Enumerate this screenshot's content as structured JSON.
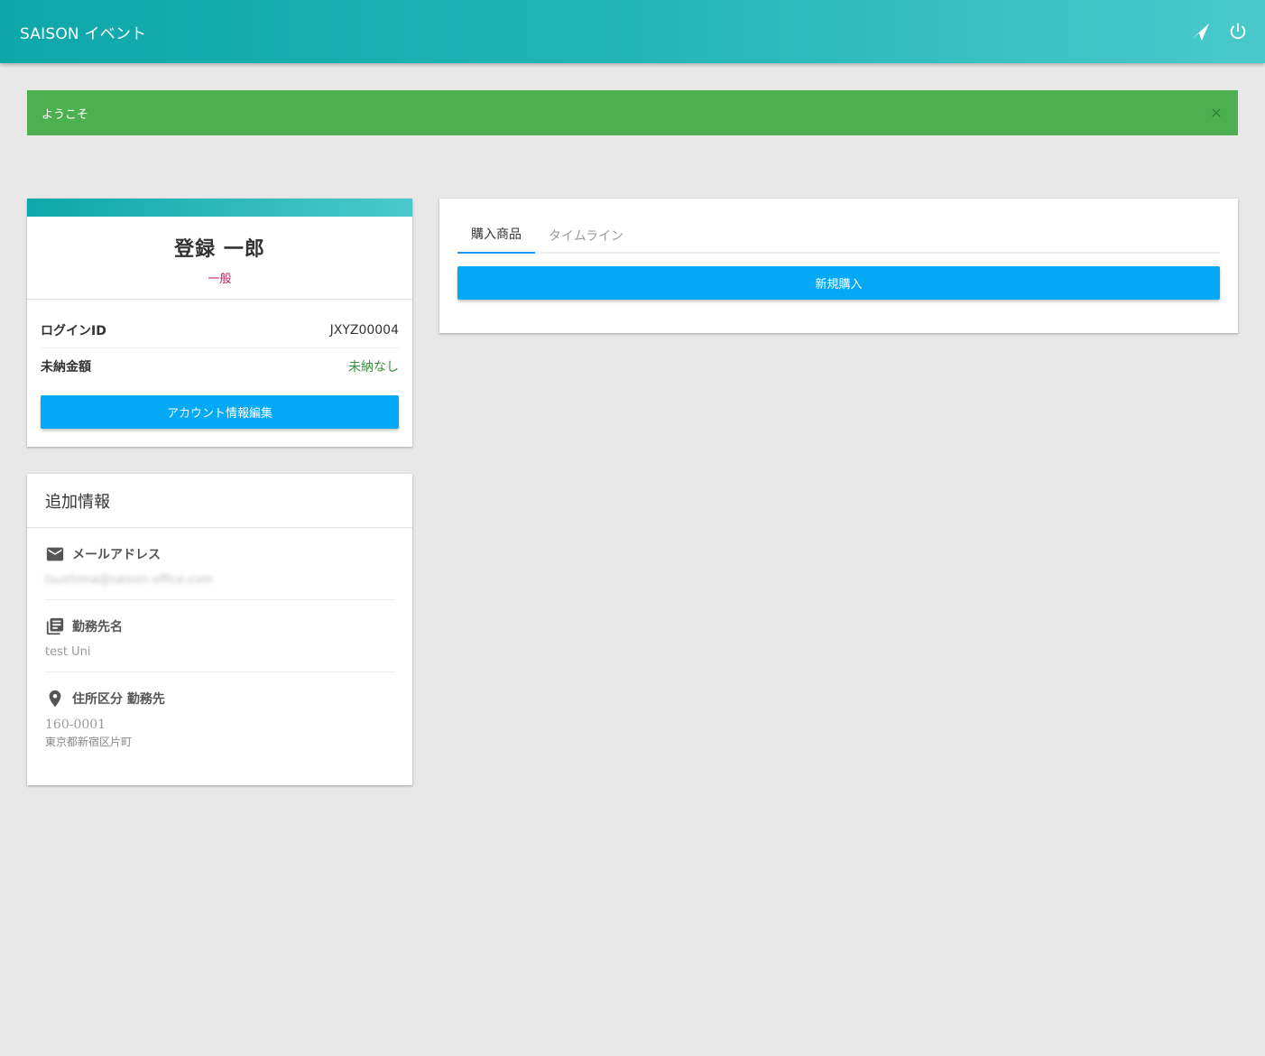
{
  "header": {
    "title": "SAISON イベント",
    "icons": [
      "send-icon",
      "power-icon"
    ]
  },
  "alert": {
    "message": "ようこそ",
    "color": "#4caf50"
  },
  "profile": {
    "name": "登録 一郎",
    "role": "一般",
    "rows": [
      {
        "label": "ログインID",
        "value": "JXYZ00004"
      },
      {
        "label": "未納金額",
        "value": "未納なし"
      }
    ],
    "edit_button": "アカウント情報編集"
  },
  "extra_info": {
    "title": "追加情報",
    "email": {
      "label": "メールアドレス",
      "value": "tsushima@saison-office.com"
    },
    "workplace": {
      "label": "勤務先名",
      "value": "test Uni"
    },
    "address": {
      "label": "住所区分 勤務先",
      "postal": "160-0001",
      "address": "東京都新宿区片町"
    }
  },
  "purchases": {
    "tabs": [
      "購入商品",
      "タイムライン"
    ],
    "active_tab": "購入商品",
    "new_purchase_button": "新規購入"
  },
  "colors": {
    "accent": "#03a9f4",
    "header_start": "#0ea7a9",
    "header_end": "#4ac9cc",
    "role": "#c2185b",
    "success_text": "#388e3c"
  }
}
